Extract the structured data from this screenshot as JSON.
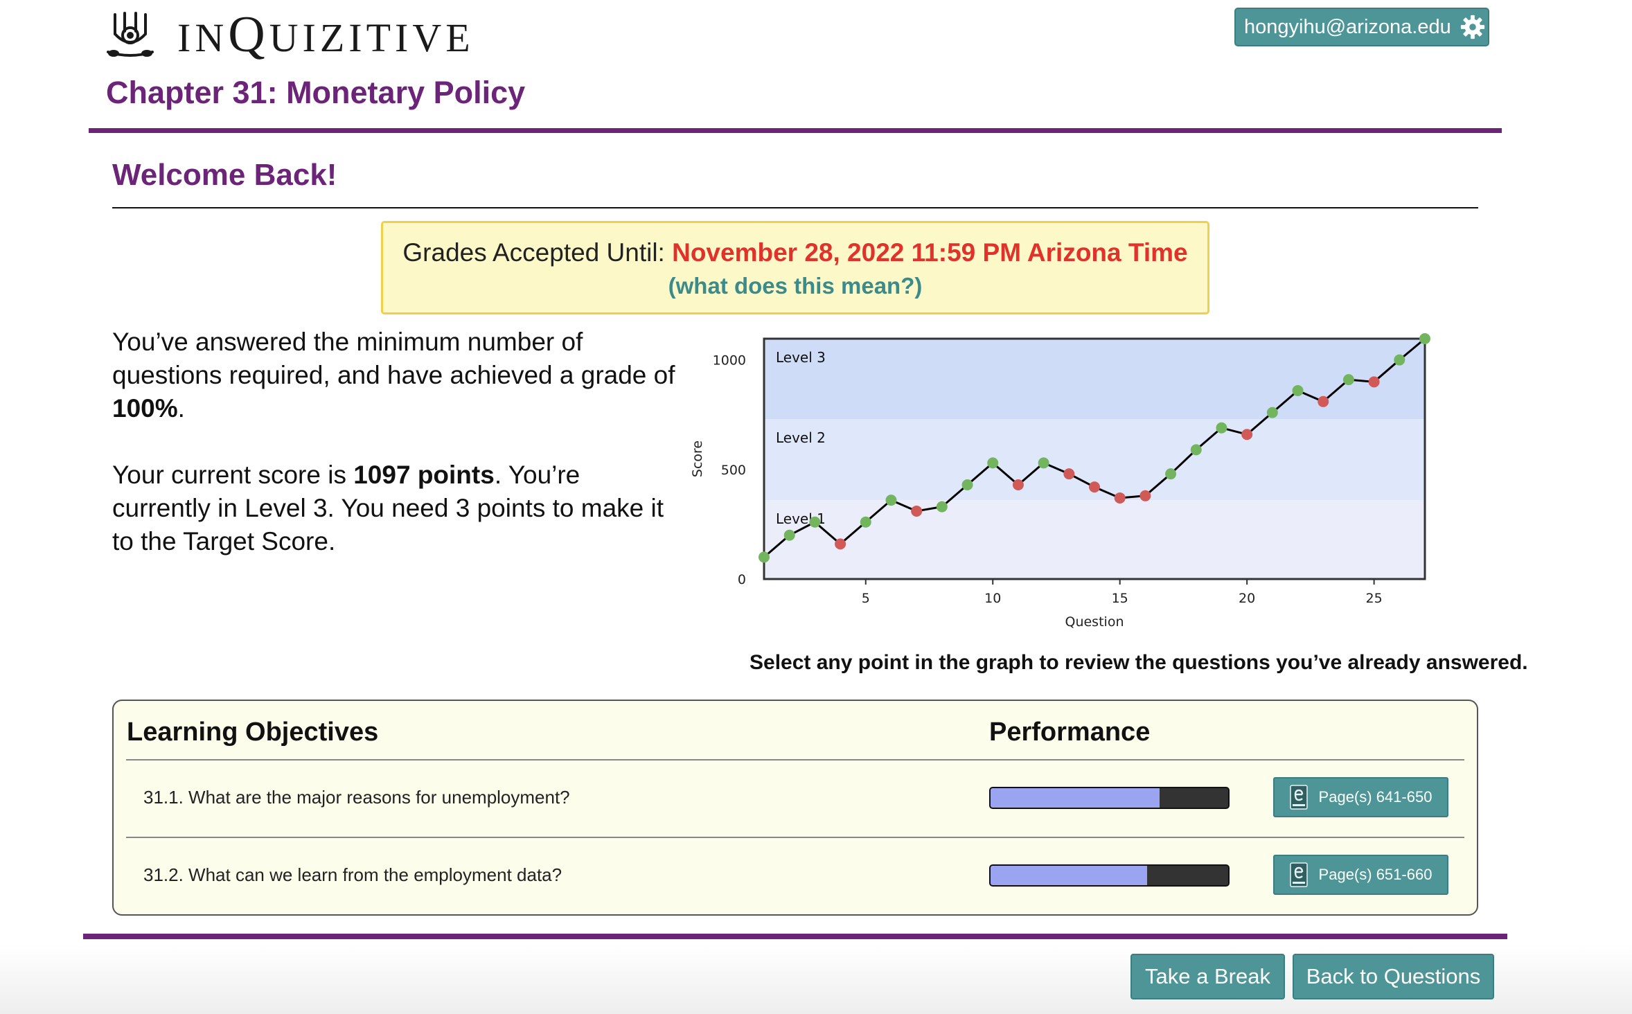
{
  "header": {
    "logo_letters": [
      "IN",
      "Q",
      "UIZITIVE"
    ],
    "user_email": "hongyihu@arizona.edu",
    "chapter_title": "Chapter 31: Monetary Policy"
  },
  "welcome": "Welcome Back!",
  "grades": {
    "label": "Grades Accepted Until: ",
    "deadline": "November 28, 2022 11:59 PM Arizona Time",
    "help_link": "(what does this mean?)",
    "deadline_color": "#e0322a"
  },
  "summary": {
    "p1_before": "You’ve answered the minimum number of questions required, and have achieved a grade of ",
    "p1_bold": "100%",
    "p1_after": ".",
    "p2_before": "Your current score is ",
    "p2_bold": "1097 points",
    "p2_after": ". You’re currently in Level 3. You need 3 points to make it to the Target Score."
  },
  "chart_data": {
    "type": "line",
    "xlabel": "Question",
    "ylabel": "Score",
    "xlim": [
      1,
      27
    ],
    "ylim": [
      0,
      1097
    ],
    "x_ticks": [
      5,
      10,
      15,
      20,
      25
    ],
    "y_ticks": [
      0,
      500,
      1000
    ],
    "bands": [
      {
        "label": "Level 1",
        "from": 0,
        "to": 360,
        "color": "#ecedfb"
      },
      {
        "label": "Level 2",
        "from": 360,
        "to": 730,
        "color": "#dfe8fb"
      },
      {
        "label": "Level 3",
        "from": 730,
        "to": 1097,
        "color": "#cfdcf8"
      }
    ],
    "series": [
      {
        "x": [
          1,
          2,
          3,
          4,
          5,
          6,
          7,
          8,
          9,
          10,
          11,
          12,
          13,
          14,
          15,
          16,
          17,
          18,
          19,
          20,
          21,
          22,
          23,
          24,
          25,
          26,
          27
        ],
        "values": [
          100,
          200,
          260,
          160,
          260,
          360,
          310,
          330,
          430,
          530,
          430,
          530,
          480,
          420,
          370,
          380,
          480,
          590,
          690,
          660,
          760,
          860,
          810,
          910,
          900,
          1000,
          1097
        ],
        "outcomes": [
          "correct",
          "correct",
          "correct",
          "incorrect",
          "correct",
          "correct",
          "incorrect",
          "correct",
          "correct",
          "correct",
          "incorrect",
          "correct",
          "incorrect",
          "incorrect",
          "incorrect",
          "incorrect",
          "correct",
          "correct",
          "correct",
          "incorrect",
          "correct",
          "correct",
          "incorrect",
          "correct",
          "incorrect",
          "correct",
          "correct"
        ]
      }
    ],
    "colors": {
      "correct": "#73b45f",
      "incorrect": "#d05a58",
      "line": "#000000"
    }
  },
  "chart_hint": "Select any point in the graph to review the questions you’ve already answered.",
  "objectives": {
    "header_objectives": "Learning Objectives",
    "header_performance": "Performance",
    "rows": [
      {
        "label": "31.1. What are the major reasons for unemployment?",
        "performance": 0.71,
        "pages": "Page(s) 641-650"
      },
      {
        "label": "31.2. What can we learn from the employment data?",
        "performance": 0.66,
        "pages": "Page(s) 651-660"
      }
    ]
  },
  "footer": {
    "take_break": "Take a Break",
    "back_to_questions": "Back to Questions"
  },
  "theme": {
    "accent_purple": "#6b2478",
    "teal_button": "#4e9597",
    "notice_bg": "#fdf8c8",
    "notice_border": "#f2cf4a"
  }
}
